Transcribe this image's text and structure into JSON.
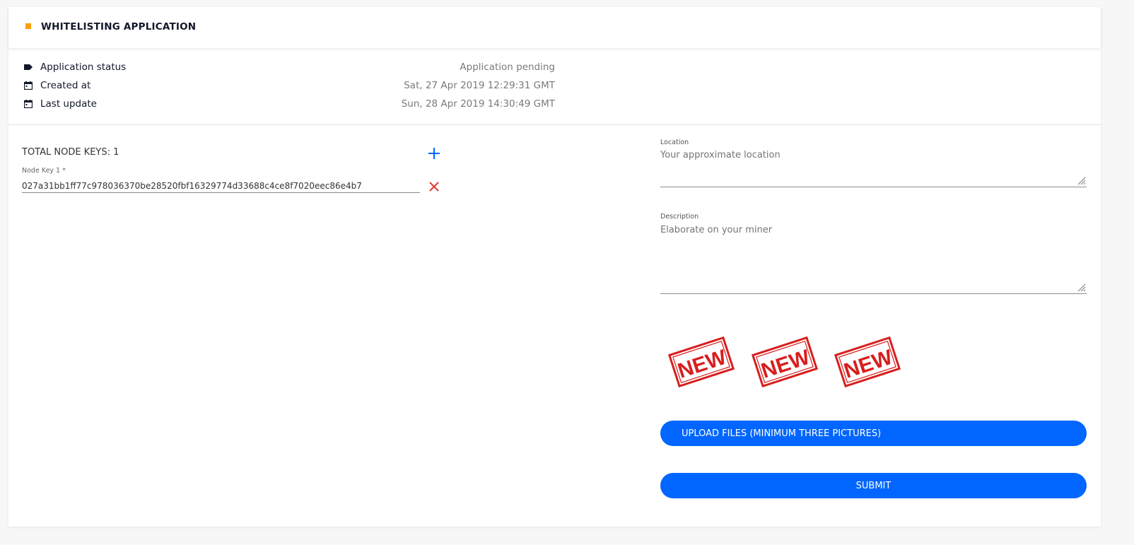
{
  "header": {
    "title": "WHITELISTING APPLICATION",
    "accent_color": "#f5a100"
  },
  "info": [
    {
      "icon": "label-tag-icon",
      "label": "Application status",
      "value": "Application pending"
    },
    {
      "icon": "calendar-icon",
      "label": "Created at",
      "value": "Sat, 27 Apr 2019 12:29:31 GMT"
    },
    {
      "icon": "calendar-icon",
      "label": "Last update",
      "value": "Sun, 28 Apr 2019 14:30:49 GMT"
    }
  ],
  "node_keys": {
    "total_label": "TOTAL NODE KEYS: 1",
    "keys": [
      {
        "label": "Node Key 1 *",
        "value": "027a31bb1ff77c978036370be28520fbf16329774d33688c4ce8f7020eec86e4b7"
      }
    ]
  },
  "location": {
    "label": "Location",
    "placeholder": "Your approximate location"
  },
  "description": {
    "label": "Description",
    "placeholder": "Elaborate on your miner"
  },
  "thumbnails": [
    {
      "icon": "new-stamp-icon",
      "text": "NEW"
    },
    {
      "icon": "new-stamp-icon",
      "text": "NEW"
    },
    {
      "icon": "new-stamp-icon",
      "text": "NEW"
    }
  ],
  "buttons": {
    "upload_label": "UPLOAD FILES (MINIMUM THREE PICTURES)",
    "submit_label": "SUBMIT",
    "primary_color": "#0066ff"
  },
  "colors": {
    "add_icon": "#0066ff",
    "remove_icon": "#e03a2f",
    "stamp_red": "#d81e1e"
  }
}
